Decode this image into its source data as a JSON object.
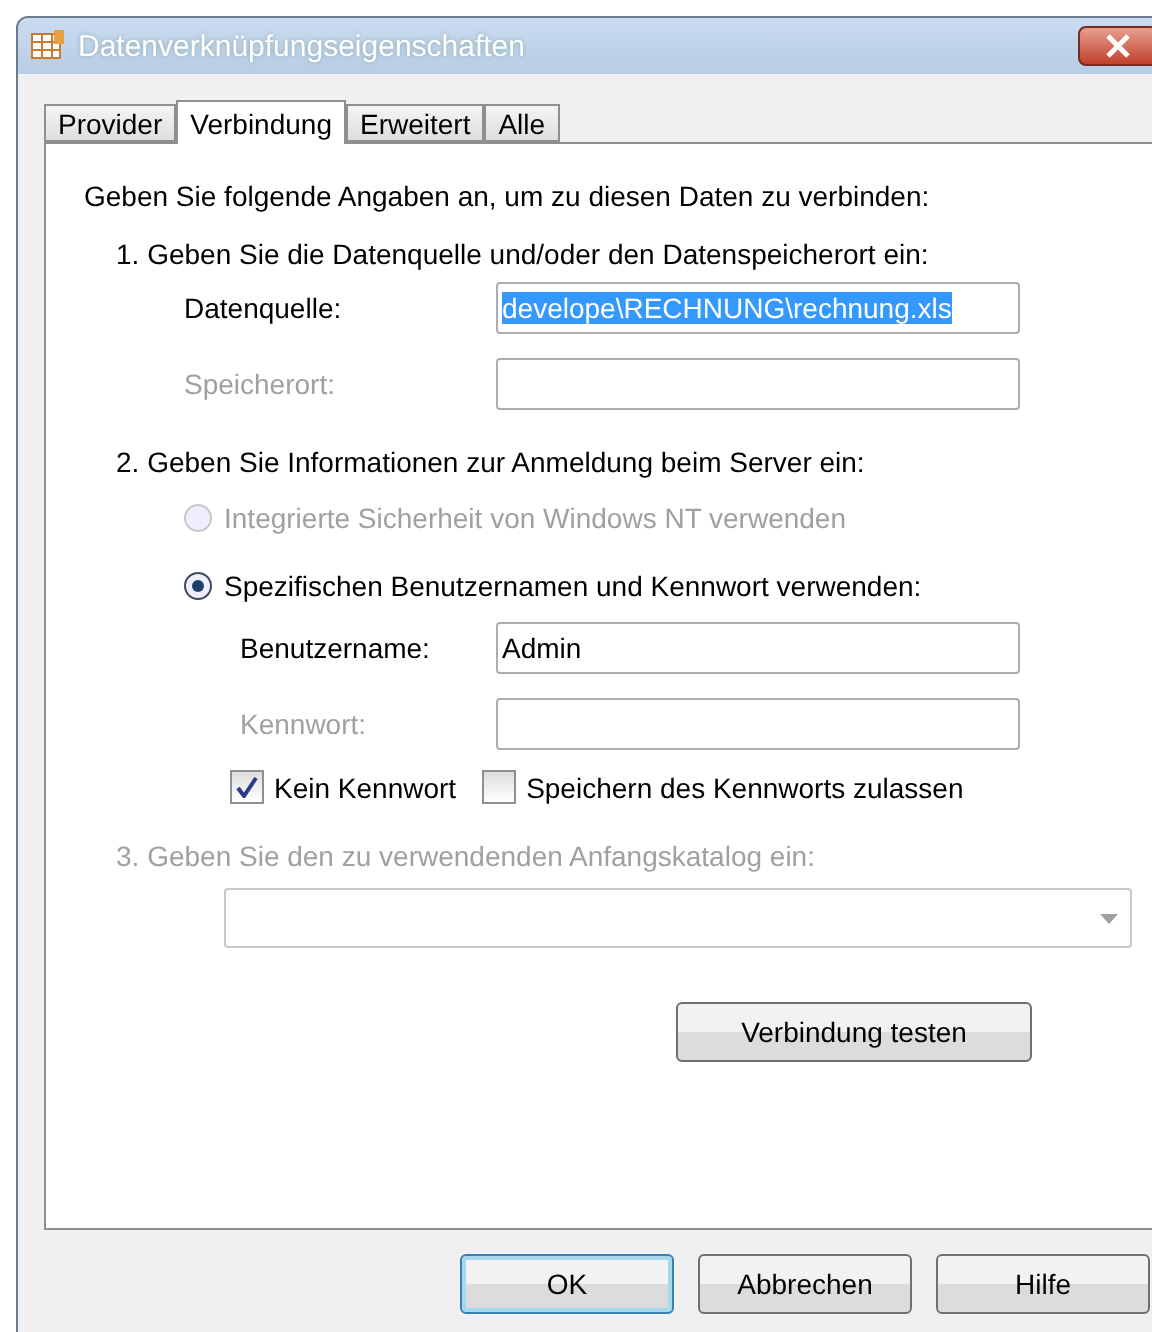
{
  "window": {
    "title": "Datenverknüpfungseigenschaften"
  },
  "tabs": [
    {
      "label": "Provider",
      "selected": false
    },
    {
      "label": "Verbindung",
      "selected": true
    },
    {
      "label": "Erweitert",
      "selected": false
    },
    {
      "label": "Alle",
      "selected": false
    }
  ],
  "intro": "Geben Sie folgende Angaben an, um zu diesen Daten zu verbinden:",
  "section1": {
    "heading": "1. Geben Sie die Datenquelle und/oder den Datenspeicherort ein:",
    "disabled": false,
    "fields": [
      {
        "label": "Datenquelle:",
        "value": "develope\\RECHNUNG\\rechnung.xls",
        "highlighted": true,
        "disabled": false
      },
      {
        "label": "Speicherort:",
        "disabled": true
      }
    ]
  },
  "section2": {
    "heading": "2. Geben Sie Informationen zur Anmeldung beim Server ein:",
    "disabled": false,
    "radios": [
      {
        "label": "Integrierte Sicherheit von Windows NT verwenden",
        "selected": false,
        "disabled": true
      },
      {
        "label": "Spezifischen Benutzernamen und Kennwort verwenden:",
        "selected": true,
        "disabled": false
      }
    ],
    "fields": [
      {
        "label": "Benutzername:",
        "value": "Admin",
        "highlighted": false,
        "disabled": false
      },
      {
        "label": "Kennwort:",
        "disabled": true
      }
    ],
    "checkboxes": [
      {
        "label": "Kein Kennwort",
        "checked": true
      },
      {
        "label": "Speichern des Kennworts zulassen",
        "checked": false
      }
    ]
  },
  "section3": {
    "heading": "3. Geben Sie den zu verwendenden Anfangskatalog ein:",
    "disabled": true
  },
  "test_button": "Verbindung testen",
  "buttons": [
    {
      "label": "OK",
      "default": true
    },
    {
      "label": "Abbrechen",
      "default": false
    },
    {
      "label": "Hilfe",
      "default": false
    }
  ]
}
